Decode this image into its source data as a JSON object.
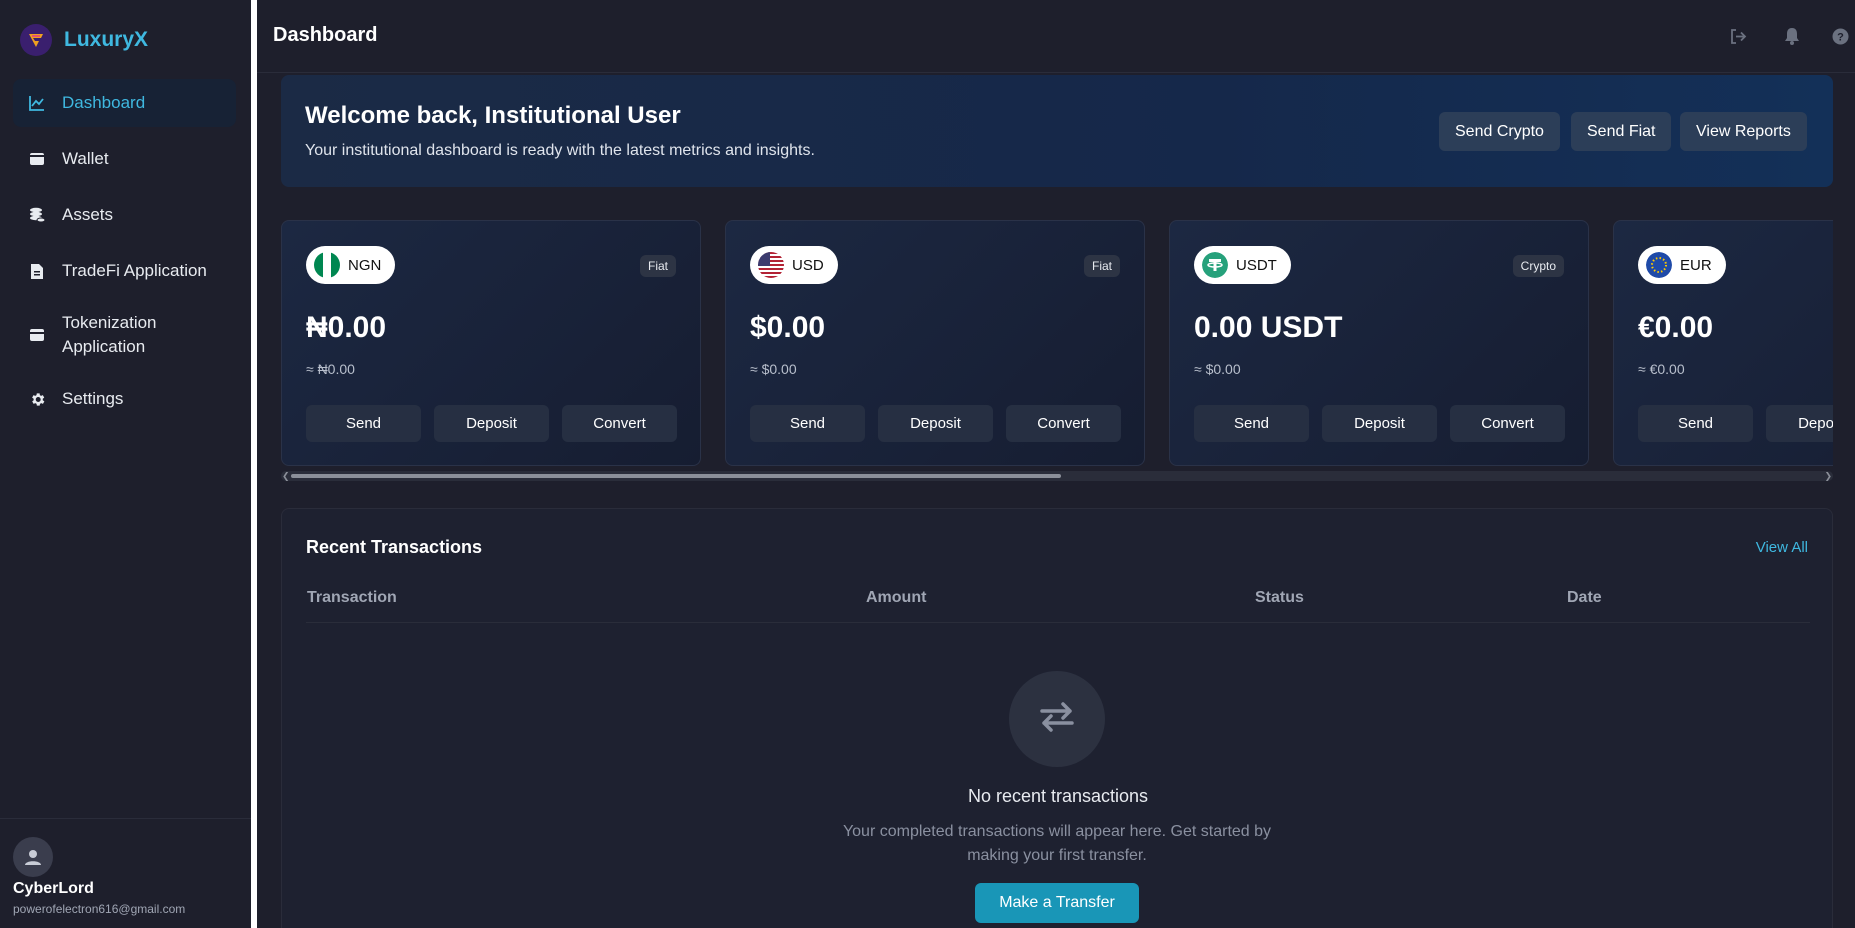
{
  "app": {
    "name": "LuxuryX"
  },
  "sidebar": {
    "items": [
      {
        "label": "Dashboard",
        "icon": "chart-line-icon",
        "active": true
      },
      {
        "label": "Wallet",
        "icon": "wallet-icon"
      },
      {
        "label": "Assets",
        "icon": "coins-icon"
      },
      {
        "label": "TradeFi Application",
        "icon": "file-invoice-icon"
      },
      {
        "label": "Tokenization Application",
        "icon": "card-icon"
      },
      {
        "label": "Settings",
        "icon": "gear-icon"
      }
    ],
    "user": {
      "name": "CyberLord",
      "email": "powerofelectron616@gmail.com"
    }
  },
  "header": {
    "title": "Dashboard",
    "icons": [
      "logout-icon",
      "bell-icon",
      "help-icon"
    ]
  },
  "welcome": {
    "title": "Welcome back, Institutional User",
    "subtitle": "Your institutional dashboard is ready with the latest metrics and insights.",
    "buttons": [
      "Send Crypto",
      "Send Fiat",
      "View Reports"
    ]
  },
  "cards": [
    {
      "code": "NGN",
      "type": "Fiat",
      "amount": "₦0.00",
      "approx": "≈ ₦0.00",
      "flag": "nigeria-flag-icon"
    },
    {
      "code": "USD",
      "type": "Fiat",
      "amount": "$0.00",
      "approx": "≈ $0.00",
      "flag": "usa-flag-icon"
    },
    {
      "code": "USDT",
      "type": "Crypto",
      "amount": "0.00 USDT",
      "approx": "≈ $0.00",
      "flag": "tether-icon"
    },
    {
      "code": "EUR",
      "type": "",
      "amount": "€0.00",
      "approx": "≈ €0.00",
      "flag": "eu-flag-icon"
    }
  ],
  "card_actions": {
    "send": "Send",
    "deposit": "Deposit",
    "convert": "Convert"
  },
  "transactions": {
    "title": "Recent Transactions",
    "view_all": "View All",
    "columns": [
      "Transaction",
      "Amount",
      "Status",
      "Date"
    ],
    "empty_title": "No recent transactions",
    "empty_desc": "Your completed transactions will appear here. Get started by making your first transfer.",
    "cta": "Make a Transfer"
  },
  "colors": {
    "accent": "#3fb8e0",
    "primary_button": "#1996b7",
    "background": "#1e1f2c"
  }
}
